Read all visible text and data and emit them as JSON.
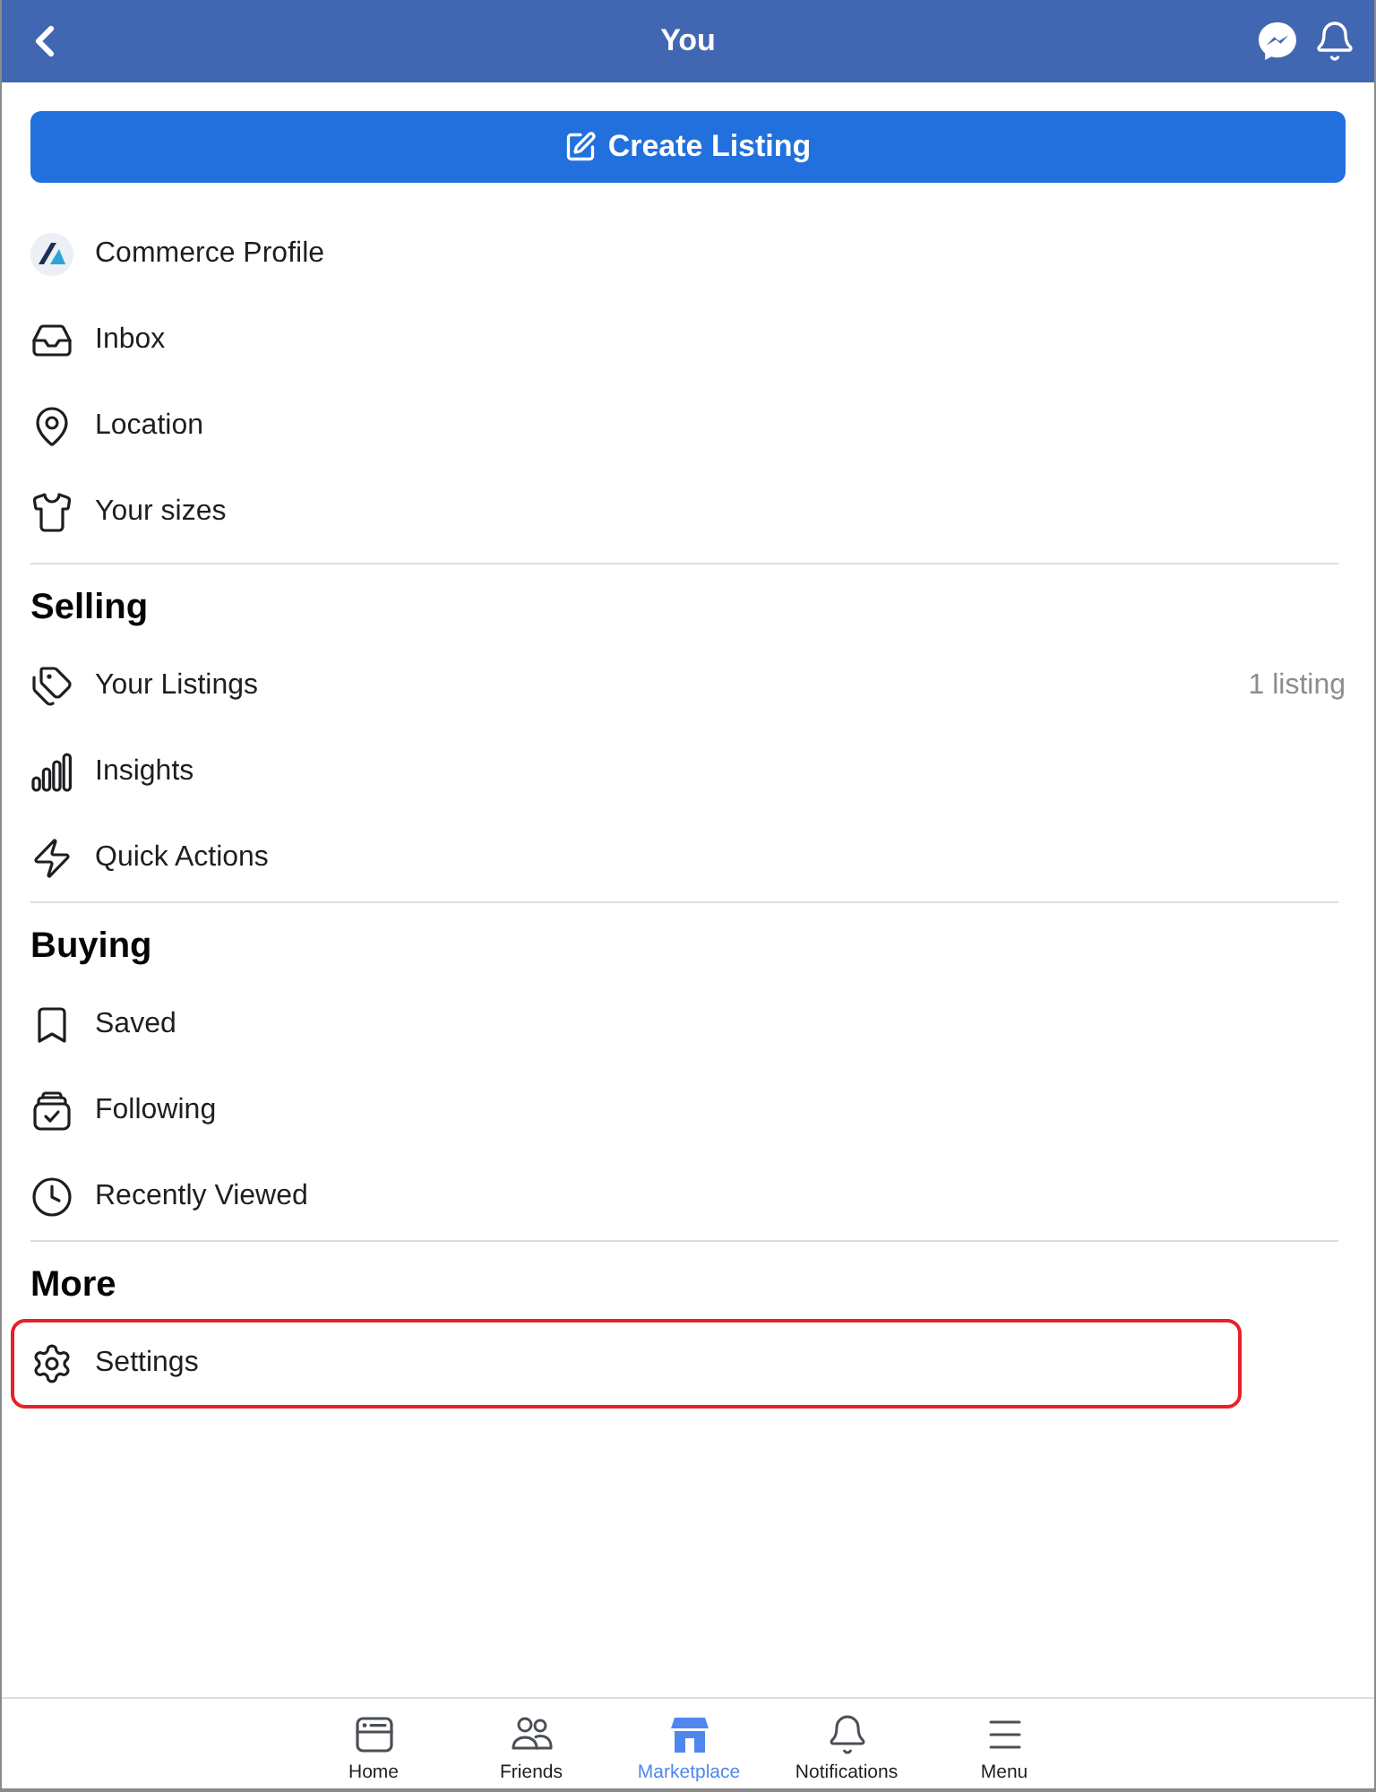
{
  "header": {
    "title": "You"
  },
  "create_button": {
    "label": "Create Listing"
  },
  "sections": [
    {
      "items": [
        {
          "kind": "profile",
          "label": "Commerce Profile",
          "highlighted": false
        },
        {
          "kind": "inbox",
          "label": "Inbox",
          "highlighted": false
        },
        {
          "kind": "location",
          "label": "Location",
          "highlighted": false
        },
        {
          "kind": "sizes",
          "label": "Your sizes",
          "highlighted": false
        }
      ]
    },
    {
      "title": "Selling",
      "items": [
        {
          "kind": "listings",
          "label": "Your Listings",
          "detail": "1 listing",
          "highlighted": false
        },
        {
          "kind": "insights",
          "label": "Insights",
          "highlighted": false
        },
        {
          "kind": "actions",
          "label": "Quick Actions",
          "highlighted": false
        }
      ]
    },
    {
      "title": "Buying",
      "items": [
        {
          "kind": "saved",
          "label": "Saved",
          "highlighted": false
        },
        {
          "kind": "following",
          "label": "Following",
          "highlighted": false
        },
        {
          "kind": "recent",
          "label": "Recently Viewed",
          "highlighted": false
        }
      ]
    },
    {
      "title": "More",
      "items": [
        {
          "kind": "settings",
          "label": "Settings",
          "highlighted": true
        }
      ]
    }
  ],
  "tabs": [
    {
      "kind": "home",
      "label": "Home",
      "selected": false
    },
    {
      "kind": "friends",
      "label": "Friends",
      "selected": false
    },
    {
      "kind": "marketplace",
      "label": "Marketplace",
      "selected": true
    },
    {
      "kind": "notifications",
      "label": "Notifications",
      "selected": false
    },
    {
      "kind": "menu",
      "label": "Menu",
      "selected": false
    }
  ]
}
